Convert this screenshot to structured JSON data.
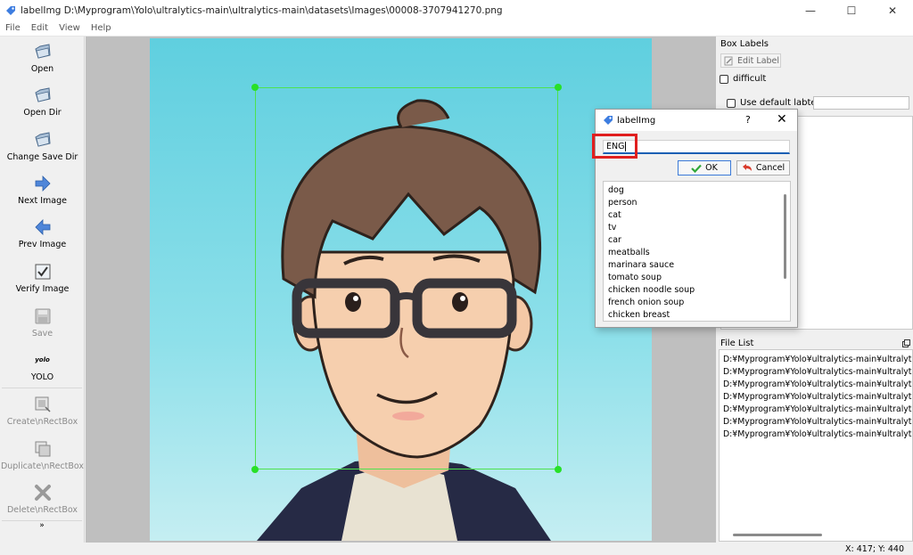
{
  "window": {
    "app_name": "labelImg",
    "title": "labelImg D:\\Myprogram\\Yolo\\ultralytics-main\\ultralytics-main\\datasets\\Images\\00008-3707941270.png",
    "controls": [
      "—",
      "☐",
      "✕"
    ]
  },
  "menu": [
    "File",
    "Edit",
    "View",
    "Help"
  ],
  "toolbar": [
    {
      "label": "Open",
      "icon": "folder-open-icon",
      "enabled": true
    },
    {
      "label": "Open Dir",
      "icon": "folder-open-icon",
      "enabled": true
    },
    {
      "label": "Change Save Dir",
      "icon": "folder-open-icon",
      "enabled": true
    },
    {
      "label": "Next Image",
      "icon": "arrow-right-icon",
      "enabled": true
    },
    {
      "label": "Prev Image",
      "icon": "arrow-left-icon",
      "enabled": true
    },
    {
      "label": "Verify Image",
      "icon": "verify-check-icon",
      "enabled": true
    },
    {
      "label": "Save",
      "icon": "save-disk-icon",
      "enabled": false
    },
    {
      "label": "YOLO",
      "icon_text": "yolo",
      "icon": "yolo-format-icon",
      "enabled": true
    },
    {
      "label": "Create\\nRectBox",
      "icon": "create-rectbox-icon",
      "enabled": false
    },
    {
      "label": "Duplicate\\nRectBox",
      "icon": "duplicate-rectbox-icon",
      "enabled": false
    },
    {
      "label": "Delete\\nRectBox",
      "icon": "delete-x-icon",
      "enabled": false
    }
  ],
  "toolbar_more": "»",
  "box_labels": {
    "title": "Box Labels",
    "edit_label": "Edit Label",
    "difficult": "difficult",
    "use_default_label": "Use default labtel"
  },
  "file_list": {
    "title": "File List",
    "items": [
      "D:¥Myprogram¥Yolo¥ultralytics-main¥ultralytics-m",
      "D:¥Myprogram¥Yolo¥ultralytics-main¥ultralytics-m",
      "D:¥Myprogram¥Yolo¥ultralytics-main¥ultralytics-m",
      "D:¥Myprogram¥Yolo¥ultralytics-main¥ultralytics-m",
      "D:¥Myprogram¥Yolo¥ultralytics-main¥ultralytics-m",
      "D:¥Myprogram¥Yolo¥ultralytics-main¥ultralytics-m",
      "D:¥Myprogram¥Yolo¥ultralytics-main¥ultralytics-m"
    ]
  },
  "dialog": {
    "title": "labelImg",
    "help": "?",
    "close": "✕",
    "input_value": "ENG",
    "ok_label": "OK",
    "cancel_label": "Cancel",
    "labels": [
      "dog",
      "person",
      "cat",
      "tv",
      "car",
      "meatballs",
      "marinara sauce",
      "tomato soup",
      "chicken noodle soup",
      "french onion soup",
      "chicken breast"
    ]
  },
  "status": {
    "coords": "X: 417; Y: 440"
  },
  "colors": {
    "bbox": "#4ee24e",
    "accent": "#1a5fb4",
    "highlight": "#e01f1f",
    "sky": "#5fcfdf"
  }
}
